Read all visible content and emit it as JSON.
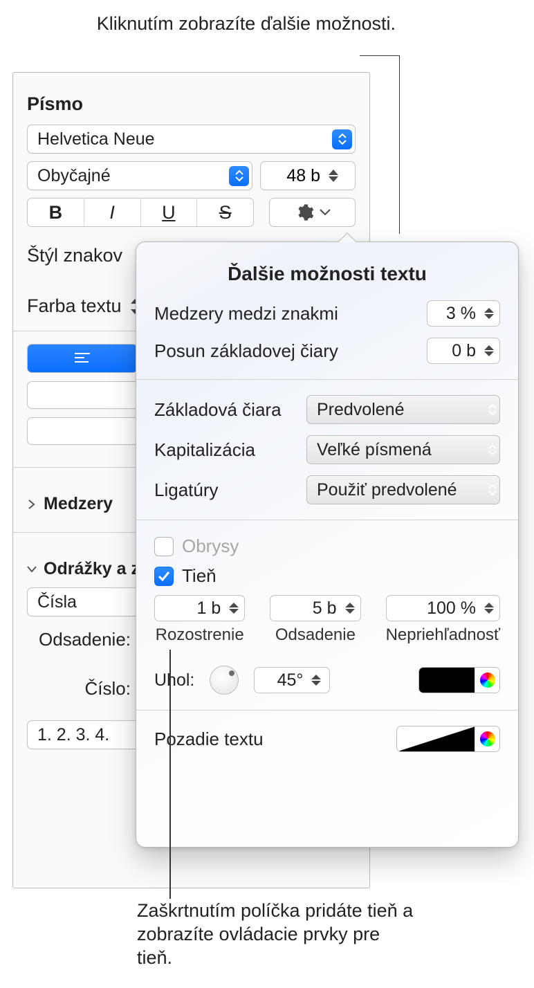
{
  "callouts": {
    "top": "Kliknutím zobrazíte ďalšie možnosti.",
    "bottom": "Zaškrtnutím políčka pridáte tieň a zobrazíte ovládacie prvky pre tieň."
  },
  "panel": {
    "font_section": "Písmo",
    "font_family": "Helvetica Neue",
    "font_style": "Obyčajné",
    "font_size": "48 b",
    "buttons": {
      "bold": "B",
      "italic": "I",
      "underline": "U",
      "strike": "S"
    },
    "char_styles_label": "Štýl znakov",
    "text_color_label": "Farba textu",
    "spacing_label": "Medzery",
    "bullets_label": "Odrážky a z",
    "bullets_type": "Čísla",
    "indent_label": "Odsadenie:",
    "number_label": "Číslo:",
    "list_format": "1. 2. 3. 4."
  },
  "popover": {
    "title": "Ďalšie možnosti textu",
    "char_spacing_label": "Medzery medzi znakmi",
    "char_spacing_value": "3 %",
    "baseline_shift_label": "Posun základovej čiary",
    "baseline_shift_value": "0 b",
    "baseline_label": "Základová čiara",
    "baseline_value": "Predvolené",
    "caps_label": "Kapitalizácia",
    "caps_value": "Veľké písmená",
    "ligatures_label": "Ligatúry",
    "ligatures_value": "Použiť predvolené",
    "outline_label": "Obrysy",
    "shadow_label": "Tieň",
    "shadow": {
      "blur_value": "1 b",
      "blur_label": "Rozostrenie",
      "offset_value": "5 b",
      "offset_label": "Odsadenie",
      "opacity_value": "100 %",
      "opacity_label": "Nepriehľadnosť",
      "angle_label": "Uhol:",
      "angle_value": "45°"
    },
    "text_bg_label": "Pozadie textu"
  }
}
